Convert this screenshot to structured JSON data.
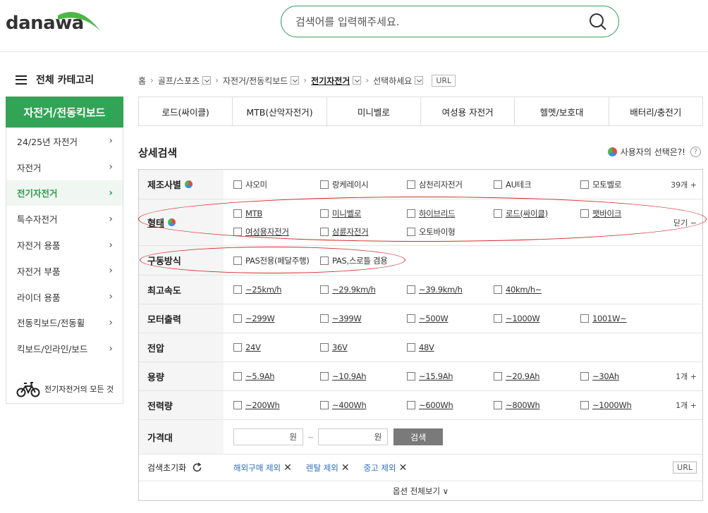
{
  "header": {
    "logo_text": "danawa",
    "search_placeholder": "검색어를 입력해주세요."
  },
  "sidebar": {
    "all_categories": "전체 카테고리",
    "title": "자전거/전동킥보드",
    "items": [
      {
        "label": "24/25년 자전거"
      },
      {
        "label": "자전거"
      },
      {
        "label": "전기자전거",
        "active": true
      },
      {
        "label": "특수자전거"
      },
      {
        "label": "자전거 용품"
      },
      {
        "label": "자전거 부품"
      },
      {
        "label": "라이더 용품"
      },
      {
        "label": "전동킥보드/전동휠"
      },
      {
        "label": "킥보드/인라인/보드"
      }
    ],
    "bottom_link": "전기자전거의 모든 것"
  },
  "breadcrumb": {
    "home": "홈",
    "level1": "골프/스포츠",
    "level2": "자전거/전동킥보드",
    "level3": "전기자전거",
    "level4": "선택하세요",
    "url": "URL"
  },
  "subtabs": [
    "로드(싸이클)",
    "MTB(산악자전거)",
    "미니벨로",
    "여성용 자전거",
    "헬멧/보호대",
    "배터리/충전기"
  ],
  "detail": {
    "title": "상세검색",
    "user_choice": "사용자의 선택은?!",
    "help": "?"
  },
  "filters": {
    "maker": {
      "label": "제조사별",
      "options": [
        "샤오미",
        "랑케레이시",
        "삼천리자전거",
        "AU테크",
        "모토벨로"
      ],
      "more": "39개 +"
    },
    "form": {
      "label": "형태",
      "options": [
        "MTB",
        "미니벨로",
        "하이브리드",
        "로드(싸이클)",
        "팻바이크",
        "여성용자전거",
        "삼륜자전거",
        "오토바이형"
      ],
      "more": "닫기 −"
    },
    "drive": {
      "label": "구동방식",
      "options": [
        "PAS전용(페달주행)",
        "PAS,스로틀 겸용"
      ]
    },
    "speed": {
      "label": "최고속도",
      "options": [
        "~25km/h",
        "~29.9km/h",
        "~39.9km/h",
        "40km/h~"
      ]
    },
    "motor": {
      "label": "모터출력",
      "options": [
        "~299W",
        "~399W",
        "~500W",
        "~1000W",
        "1001W~"
      ]
    },
    "voltage": {
      "label": "전압",
      "options": [
        "24V",
        "36V",
        "48V"
      ]
    },
    "capacity": {
      "label": "용량",
      "options": [
        "~5.9Ah",
        "~10.9Ah",
        "~15.9Ah",
        "~20.9Ah",
        "~30Ah"
      ],
      "more": "1개 +"
    },
    "energy": {
      "label": "전력량",
      "options": [
        "~200Wh",
        "~400Wh",
        "~600Wh",
        "~800Wh",
        "~1000Wh"
      ],
      "more": "1개 +"
    },
    "price": {
      "label": "가격대",
      "unit": "원",
      "tilde": "~",
      "button": "검색"
    }
  },
  "reset": {
    "label": "검색초기화",
    "exclusions": [
      "해외구매 제외",
      "렌탈 제외",
      "중고 제외"
    ],
    "url": "URL"
  },
  "see_all": "옵션 전체보기 ∨",
  "colors": {
    "brand_green": "#33a456",
    "highlight_red": "#d42b2b",
    "link_blue": "#2d6fbd"
  }
}
